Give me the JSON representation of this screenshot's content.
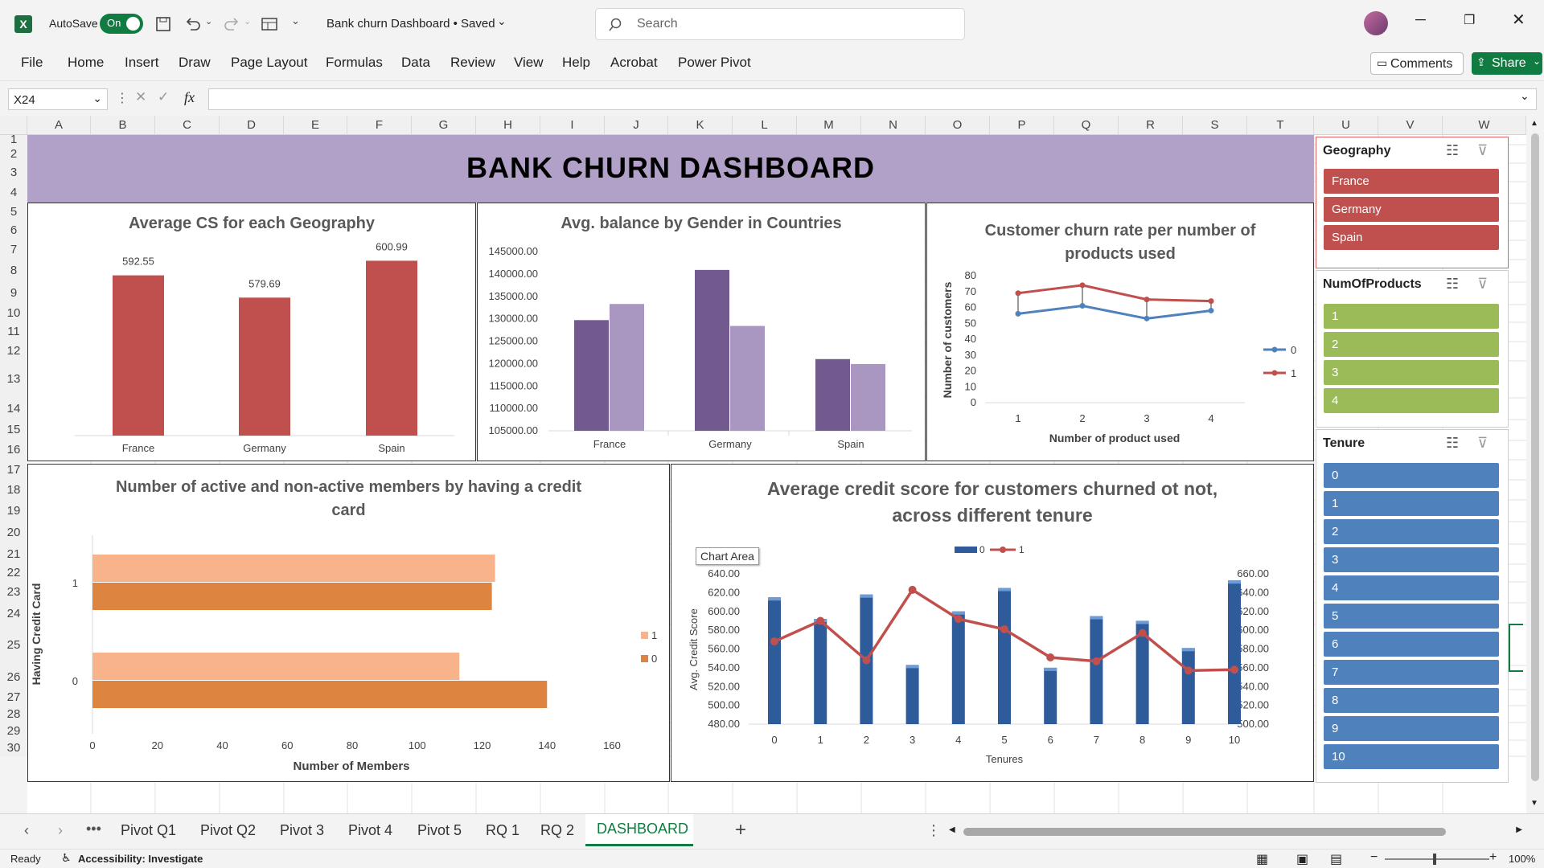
{
  "titlebar": {
    "autosave": "AutoSave",
    "toggle": "On",
    "doc_title": "Bank churn Dashboard • Saved",
    "search_placeholder": "Search"
  },
  "menu": {
    "items": [
      "File",
      "Home",
      "Insert",
      "Draw",
      "Page Layout",
      "Formulas",
      "Data",
      "Review",
      "View",
      "Help",
      "Acrobat",
      "Power Pivot"
    ],
    "comments": "Comments",
    "share": "Share"
  },
  "formula": {
    "namebox": "X24",
    "fx": "fx",
    "value": ""
  },
  "columns": [
    "A",
    "B",
    "C",
    "D",
    "E",
    "F",
    "G",
    "H",
    "I",
    "J",
    "K",
    "L",
    "M",
    "N",
    "O",
    "P",
    "Q",
    "R",
    "S",
    "T",
    "U",
    "V",
    "W"
  ],
  "rows": [
    "1",
    "2",
    "3",
    "4",
    "5",
    "6",
    "7",
    "8",
    "9",
    "10",
    "11",
    "12",
    "13",
    "14",
    "15",
    "16",
    "17",
    "18",
    "19",
    "20",
    "21",
    "22",
    "23",
    "24",
    "25",
    "26",
    "27",
    "28",
    "29",
    "30"
  ],
  "dashboard": {
    "title": "BANK CHURN DASHBOARD",
    "colors": {
      "banner": "#b1a0c7",
      "red": "#c0504d",
      "purple_dark": "#725a8f",
      "purple_light": "#a996c1",
      "peach": "#f9b38b",
      "orange": "#dd8440",
      "blue": "#4f81bd",
      "green": "#9bbb59"
    }
  },
  "chart_data": [
    {
      "type": "bar",
      "title": "Average CS for each Geography",
      "categories": [
        "France",
        "Germany",
        "Spain"
      ],
      "values": [
        592.55,
        579.69,
        600.99
      ],
      "labels": [
        "592.55",
        "579.69",
        "600.99"
      ],
      "color": "#c0504d"
    },
    {
      "type": "bar",
      "title": "Avg. balance by Gender in Countries",
      "categories": [
        "France",
        "Germany",
        "Spain"
      ],
      "series": [
        {
          "values": [
            129700,
            140900,
            121000
          ],
          "color": "#725a8f"
        },
        {
          "values": [
            133300,
            128400,
            119900
          ],
          "color": "#a996c1"
        }
      ],
      "ylim": [
        105000,
        145000
      ],
      "yticks": [
        "145000.00",
        "140000.00",
        "135000.00",
        "130000.00",
        "125000.00",
        "120000.00",
        "115000.00",
        "110000.00",
        "105000.00"
      ]
    },
    {
      "type": "line",
      "title": "Customer churn rate per number of products used",
      "x": [
        "1",
        "2",
        "3",
        "4"
      ],
      "series": [
        {
          "name": "0",
          "values": [
            56,
            61,
            53,
            58
          ],
          "color": "#4f81bd"
        },
        {
          "name": "1",
          "values": [
            69,
            74,
            65,
            64
          ],
          "color": "#c0504d"
        }
      ],
      "ylim": [
        0,
        80
      ],
      "yticks": [
        "80",
        "70",
        "60",
        "50",
        "40",
        "30",
        "20",
        "10",
        "0"
      ],
      "xlabel": "Number of product used",
      "ylabel": "Number of customers"
    },
    {
      "type": "bar",
      "orientation": "horizontal",
      "title": "Number of active and non-active members by having a credit card",
      "categories": [
        "1",
        "0"
      ],
      "series": [
        {
          "name": "1",
          "values": [
            124,
            113
          ],
          "color": "#f9b38b"
        },
        {
          "name": "0",
          "values": [
            123,
            140
          ],
          "color": "#dd8440"
        }
      ],
      "xlim": [
        0,
        160
      ],
      "xticks": [
        "0",
        "20",
        "40",
        "60",
        "80",
        "100",
        "120",
        "140",
        "160"
      ],
      "xlabel": "Number of Members",
      "ylabel": "Having Credit Card"
    },
    {
      "type": "bar+line",
      "title": "Average credit score for customers churned ot not, across different tenure",
      "x": [
        "0",
        "1",
        "2",
        "3",
        "4",
        "5",
        "6",
        "7",
        "8",
        "9",
        "10"
      ],
      "bars": {
        "name": "0",
        "values": [
          615,
          592,
          618,
          543,
          600,
          625,
          540,
          595,
          590,
          561,
          633
        ],
        "color": "#2e5c9a"
      },
      "line": {
        "name": "1",
        "values": [
          588,
          610,
          568,
          643,
          612,
          601,
          571,
          567,
          597,
          557,
          558
        ],
        "color": "#c0504d"
      },
      "ylim_left": [
        480,
        640
      ],
      "ylim_right": [
        500,
        660
      ],
      "yticks_left": [
        "640.00",
        "620.00",
        "600.00",
        "580.00",
        "560.00",
        "540.00",
        "520.00",
        "500.00",
        "480.00"
      ],
      "yticks_right": [
        "660.00",
        "640.00",
        "620.00",
        "600.00",
        "580.00",
        "560.00",
        "540.00",
        "520.00",
        "500.00"
      ],
      "xlabel": "Tenures",
      "ylabel": "Avg. Credit Score",
      "tooltip": "Chart Area"
    }
  ],
  "slicers": {
    "geography": {
      "title": "Geography",
      "items": [
        "France",
        "Germany",
        "Spain"
      ]
    },
    "products": {
      "title": "NumOfProducts",
      "items": [
        "1",
        "2",
        "3",
        "4"
      ]
    },
    "tenure": {
      "title": "Tenure",
      "items": [
        "0",
        "1",
        "2",
        "3",
        "4",
        "5",
        "6",
        "7",
        "8",
        "9",
        "10"
      ]
    }
  },
  "tabs": {
    "items": [
      "Pivot Q1",
      "Pivot Q2",
      "Pivot 3",
      "Pivot 4",
      "Pivot 5",
      "RQ 1",
      "RQ 2",
      "DASHBOARD"
    ],
    "active": "DASHBOARD"
  },
  "status": {
    "ready": "Ready",
    "accessibility": "Accessibility: Investigate",
    "zoom": "100%"
  }
}
